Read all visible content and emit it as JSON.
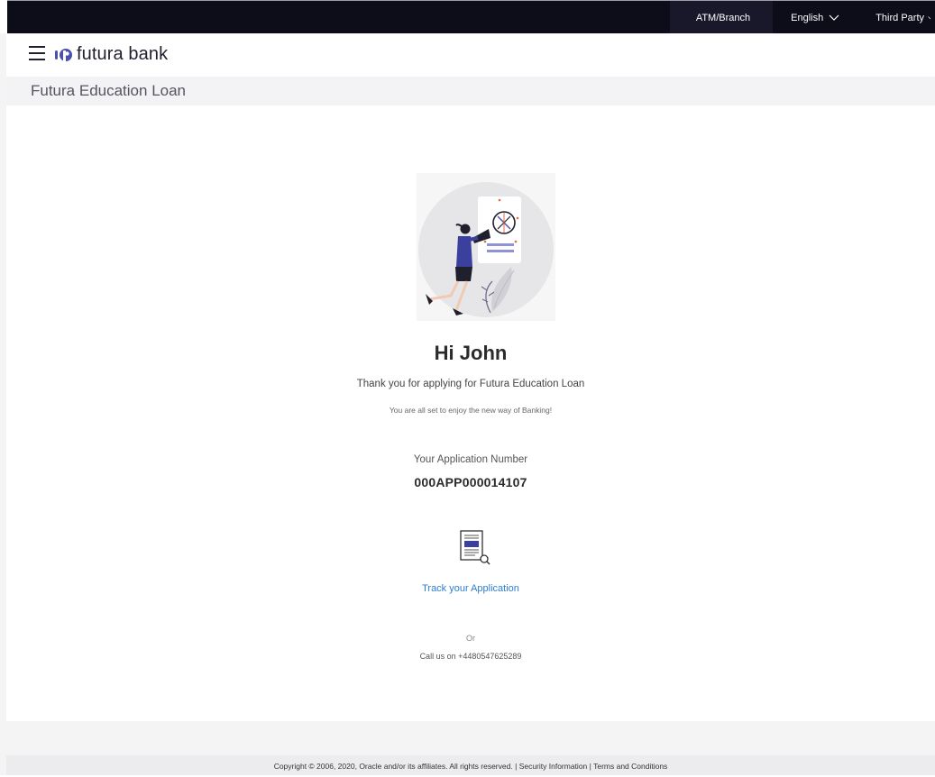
{
  "topbar": {
    "atm_branch": "ATM/Branch",
    "language": "English",
    "third_party": "Third Party"
  },
  "header": {
    "brand": "futura bank"
  },
  "page": {
    "title": "Futura Education Loan"
  },
  "confirmation": {
    "greeting": "Hi John",
    "thanks": "Thank you for applying for Futura Education Loan",
    "subtext": "You are all set to enjoy the new way of Banking!",
    "application_label": "Your Application Number",
    "application_number": "000APP000014107",
    "track_link": "Track your Application",
    "or": "Or",
    "call": "Call us on +4480547625289"
  },
  "footer": {
    "copyright": "Copyright © 2006, 2020, Oracle and/or its affiliates. All rights reserved.",
    "separator": "|",
    "security": "Security Information",
    "terms": "Terms and Conditions"
  },
  "colors": {
    "topbar_bg": "#0d0d1a",
    "link": "#2d7ecf",
    "accent": "#4a4fb0"
  }
}
